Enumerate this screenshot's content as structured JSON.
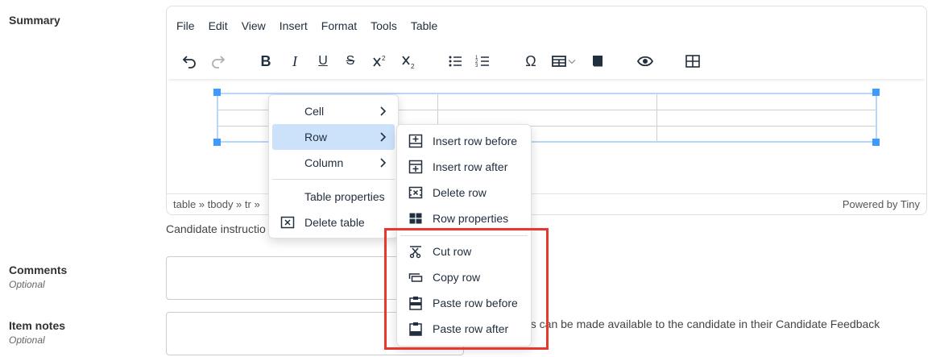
{
  "fields": {
    "summary_label": "Summary",
    "comments_label": "Comments",
    "comments_optional": "Optional",
    "item_notes_label": "Item notes",
    "item_notes_optional": "Optional"
  },
  "menubar": [
    "File",
    "Edit",
    "View",
    "Insert",
    "Format",
    "Tools",
    "Table"
  ],
  "toolbar": {
    "bold": "B",
    "italic": "I",
    "underline": "U",
    "strike": "S",
    "omega": "Ω"
  },
  "statusbar": {
    "path": "table » tbody » tr »",
    "powered": "Powered by Tiny"
  },
  "candidate_instructions": "Candidate instructio",
  "help_text": "es can be made available to the candidate in their Candidate Feedback",
  "context_menu": {
    "items": [
      "Cell",
      "Row",
      "Column",
      "Table properties",
      "Delete table"
    ]
  },
  "row_submenu": {
    "items": [
      "Insert row before",
      "Insert row after",
      "Delete row",
      "Row properties",
      "Cut row",
      "Copy row",
      "Paste row before",
      "Paste row after"
    ]
  },
  "colors": {
    "accent": "#4099ff",
    "active_item": "#cce2fa",
    "highlight": "#e8372c"
  }
}
